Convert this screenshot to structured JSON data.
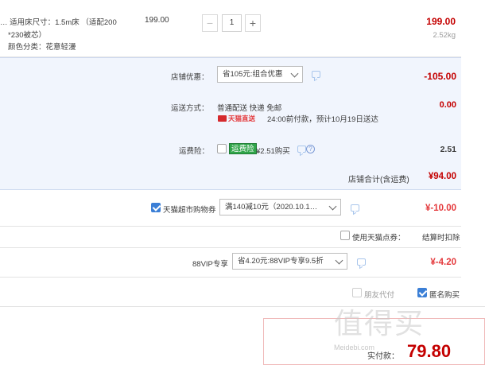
{
  "product": {
    "spec_line1": "…  适用床尺寸：1.5m床 （适配200",
    "spec_line2": "*230被芯）",
    "spec_line3": "颜色分类：花意轻漫",
    "unit_price": "199.00",
    "quantity": "1",
    "minus": "−",
    "plus": "+",
    "total": "199.00",
    "weight": "2.52kg"
  },
  "shop": {
    "discount_label": "店铺优惠：",
    "discount_select": "省105元:组合优惠",
    "discount_amount": "-105.00",
    "shipping_label": "运送方式：",
    "shipping_method": "普通配送 快递 免邮",
    "tmall_direct": "天猫直送",
    "delivery_note": "24:00前付款，预计10月19日送达",
    "shipping_amount": "0.00",
    "insurance_label": "运费险：",
    "insurance_tag": "运费险",
    "insurance_price": "¥2.51购买",
    "insurance_amount": "2.51",
    "subtotal_label": "店铺合计(含运费)",
    "subtotal_amount": "¥94.00"
  },
  "coupon": {
    "label": "天猫超市购物券",
    "checked": true,
    "select": "满140减10元（2020.10.1…",
    "amount": "¥-10.00"
  },
  "points": {
    "label": "使用天猫点券：",
    "checked": false,
    "note": "结算时扣除"
  },
  "vip": {
    "label": "88VIP专享",
    "select": "省4.20元:88VIP专享9.5折",
    "amount": "¥-4.20"
  },
  "options": {
    "friend_pay": "朋友代付",
    "friend_pay_checked": false,
    "anonymous": "匿名购买",
    "anonymous_checked": true
  },
  "footer": {
    "actual_label": "实付款：",
    "actual_amount": "79.80",
    "watermark": "值得买",
    "watermark_sub": "Meidebi.com"
  },
  "colors": {
    "accent_red": "#e4393c",
    "price_crimson": "#c40000",
    "panel_blue": "#f1f5fd",
    "checkbox_blue": "#3b7fd6",
    "insurance_green": "#30a54a"
  },
  "icons": [
    "chevron-down-icon",
    "chat-icon",
    "question-icon",
    "tmall-icon",
    "checkbox"
  ]
}
